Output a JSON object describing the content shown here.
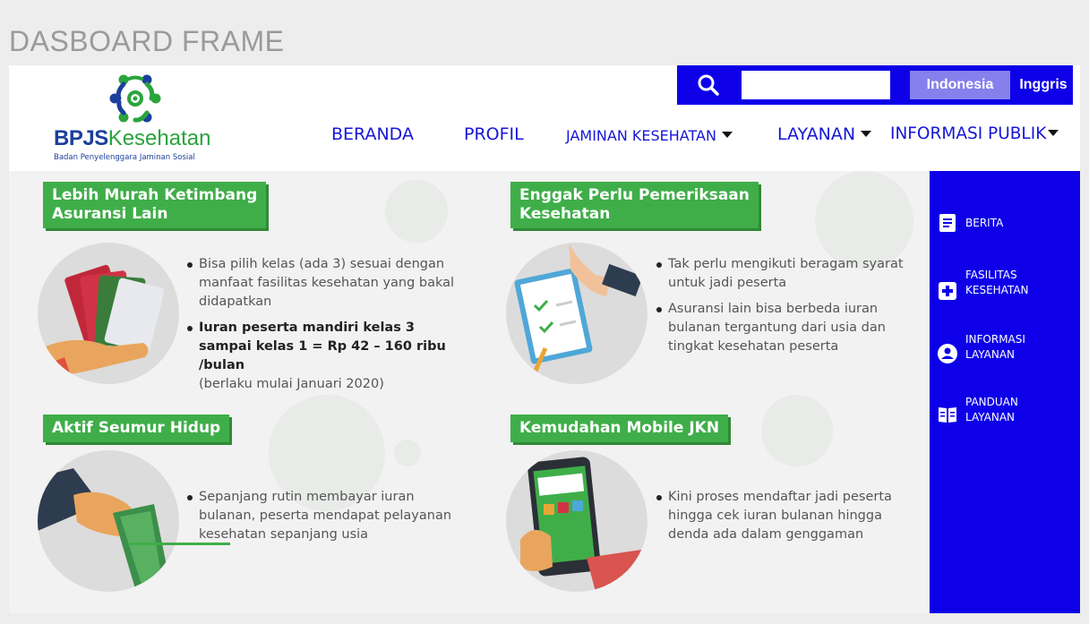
{
  "frame": {
    "title": "DASBOARD FRAME"
  },
  "logo": {
    "brand_bold": "BPJS",
    "brand_light": "Kesehatan",
    "subtitle": "Badan Penyelenggara Jaminan Sosial"
  },
  "search": {
    "placeholder": "",
    "value": ""
  },
  "language": {
    "active": "Indonesia",
    "other": "Inggris"
  },
  "nav": [
    {
      "label": "BERANDA",
      "dropdown": false
    },
    {
      "label": "PROFIL",
      "dropdown": false
    },
    {
      "label": "JAMINAN KESEHATAN",
      "dropdown": true
    },
    {
      "label": "LAYANAN",
      "dropdown": true
    },
    {
      "label": "INFORMASI PUBLIK",
      "dropdown": true
    }
  ],
  "sections": [
    {
      "title_line1": "Lebih Murah Ketimbang",
      "title_line2": "Asuransi Lain",
      "bullets": [
        "Bisa pilih kelas (ada 3) sesuai dengan manfaat fasilitas kesehatan yang bakal didapatkan",
        "Iuran peserta mandiri kelas 3 sampai kelas 1 = Rp 42 – 160 ribu /bulan",
        "(berlaku mulai Januari 2020)"
      ]
    },
    {
      "title_line1": "Enggak Perlu Pemeriksaan",
      "title_line2": "Kesehatan",
      "bullets": [
        "Tak perlu mengikuti beragam syarat untuk jadi peserta",
        "Asuransi lain bisa berbeda iuran bulanan tergantung dari usia dan tingkat kesehatan peserta"
      ]
    },
    {
      "title_line1": "Aktif Seumur Hidup",
      "bullets": [
        "Sepanjang rutin membayar iuran bulanan, peserta mendapat pelayanan kesehatan sepanjang usia"
      ]
    },
    {
      "title_line1": "Kemudahan Mobile JKN",
      "bullets": [
        "Kini proses mendaftar jadi peserta hingga cek iuran bulanan hingga denda ada dalam genggaman"
      ]
    }
  ],
  "sidebar": [
    {
      "icon": "document-icon",
      "label": "BERITA"
    },
    {
      "icon": "medical-cross-icon",
      "label": "FASILITAS KESEHATAN"
    },
    {
      "icon": "user-circle-icon",
      "label": "INFORMASI LAYANAN"
    },
    {
      "icon": "book-icon",
      "label": "PANDUAN LAYANAN"
    }
  ],
  "colors": {
    "primary_blue": "#0d00e8",
    "nav_blue": "#1616d8",
    "brand_green": "#3fae49",
    "lang_active_bg": "#8680ec"
  }
}
